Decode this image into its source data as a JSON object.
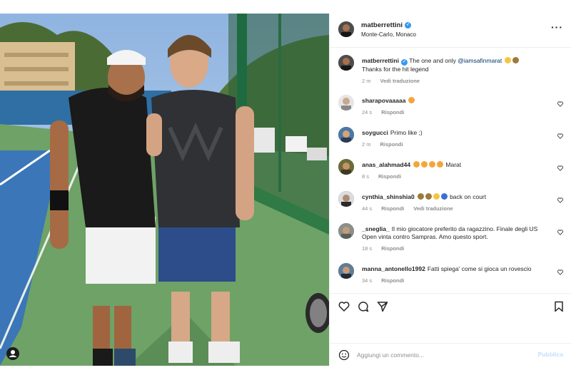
{
  "post": {
    "username": "matberrettini",
    "location": "Monte-Carlo, Monaco",
    "more_icon": "more-horizontal-icon"
  },
  "caption": {
    "username": "matberrettini",
    "text_before": "The one and only ",
    "mention": "@iamsafinmarat",
    "text_after": "Thanks for the hit legend",
    "emojis": [
      "flexed-biceps",
      "tennis-racket"
    ],
    "time": "2 m",
    "translate": "Vedi traduzione"
  },
  "comments": [
    {
      "username": "sharapovaaaaa",
      "text": "",
      "emojis": [
        "heart-eyes"
      ],
      "time": "24 s",
      "reply": "Rispondi"
    },
    {
      "username": "soygucci",
      "text": "Primo like ;)",
      "time": "2 m",
      "reply": "Rispondi"
    },
    {
      "username": "anas_alahmad44",
      "text": "Marat",
      "emojis": [
        "heart-eyes",
        "heart-eyes",
        "heart-eyes",
        "heart-eyes"
      ],
      "time": "8 s",
      "reply": "Rispondi"
    },
    {
      "username": "cynthia_shinshia0",
      "text": "back on court",
      "emojis": [
        "tennis-racket",
        "tennis-racket",
        "flexed-biceps",
        "tennis-ball"
      ],
      "time": "44 s",
      "reply": "Rispondi",
      "translate": "Vedi traduzione"
    },
    {
      "username": "_sneglia_",
      "text": "Il mio giocatore preferito da ragazzino. Finale degli US Open vinta contro Sampras. Amo questo sport.",
      "time": "18 s",
      "reply": "Rispondi"
    },
    {
      "username": "manna_antonello1992",
      "text": "Fatti spiega' come si gioca un rovescio",
      "time": "34 s",
      "reply": "Rispondi"
    }
  ],
  "add_comment": {
    "placeholder": "Aggiungi un commento...",
    "publish": "Pubblica"
  },
  "colors": {
    "verified": "#3897f0",
    "meta_text": "#8e8e8e",
    "publish_disabled": "#c0dffd",
    "mention": "#00376b"
  }
}
